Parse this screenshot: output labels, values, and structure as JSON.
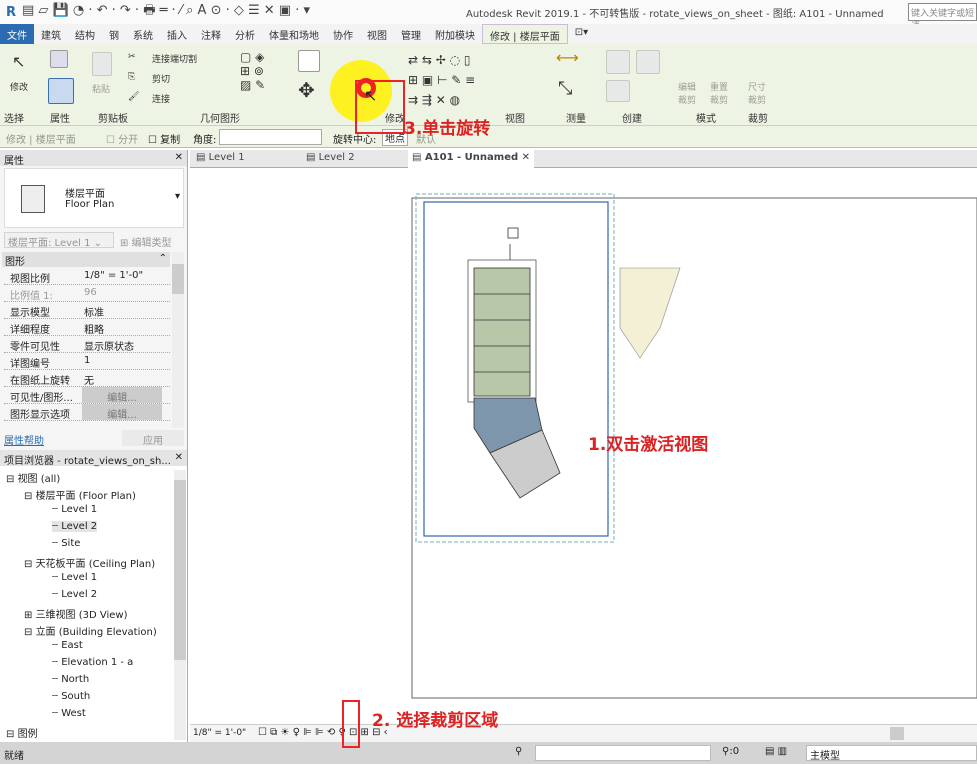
{
  "app": {
    "title": "Autodesk Revit 2019.1 - 不可转售版 - rotate_views_on_sheet - 图纸: A101 - Unnamed",
    "search_placeholder": "键入关键字或短语"
  },
  "menu_tabs": [
    "文件",
    "建筑",
    "结构",
    "钢",
    "系统",
    "插入",
    "注释",
    "分析",
    "体量和场地",
    "协作",
    "视图",
    "管理",
    "附加模块",
    "修改 | 楼层平面"
  ],
  "ribbon": {
    "buttons": [
      "修改",
      "粘贴",
      "连接端切割",
      "剪切",
      "连接"
    ],
    "groups": [
      "选择",
      "属性",
      "剪贴板",
      "几何图形",
      "修改",
      "视图",
      "测量",
      "创建",
      "模式",
      "裁剪"
    ],
    "crop_buttons": [
      "编辑裁剪",
      "重置裁剪",
      "尺寸裁剪"
    ]
  },
  "options_bar": {
    "context": "修改 | 楼层平面",
    "split": "分开",
    "copy": "复制",
    "angle_label": "角度:",
    "angle_value": "",
    "center_label": "旋转中心:",
    "place": "地点",
    "default": "默认"
  },
  "properties": {
    "title": "属性",
    "type_cn": "楼层平面",
    "type_en": "Floor Plan",
    "selector": "楼层平面: Level 1",
    "edit_type": "编辑类型",
    "section": "图形",
    "rows": [
      {
        "k": "视图比例",
        "v": "1/8\" = 1'-0\""
      },
      {
        "k": "比例值 1:",
        "v": "96"
      },
      {
        "k": "显示模型",
        "v": "标准"
      },
      {
        "k": "详细程度",
        "v": "粗略"
      },
      {
        "k": "零件可见性",
        "v": "显示原状态"
      },
      {
        "k": "详图编号",
        "v": "1"
      },
      {
        "k": "在图纸上旋转",
        "v": "无"
      },
      {
        "k": "可见性/图形...",
        "v": "编辑..."
      },
      {
        "k": "图形显示选项",
        "v": "编辑..."
      }
    ],
    "help": "属性帮助",
    "apply": "应用"
  },
  "browser": {
    "title": "项目浏览器 - rotate_views_on_sh...",
    "items": [
      {
        "label": "视图 (all)",
        "level": 0
      },
      {
        "label": "楼层平面 (Floor Plan)",
        "level": 1
      },
      {
        "label": "Level 1",
        "level": 2
      },
      {
        "label": "Level 2",
        "level": 2,
        "selected": true
      },
      {
        "label": "Site",
        "level": 2
      },
      {
        "label": "天花板平面 (Ceiling Plan)",
        "level": 1
      },
      {
        "label": "Level 1",
        "level": 2
      },
      {
        "label": "Level 2",
        "level": 2
      },
      {
        "label": "三维视图 (3D View)",
        "level": 1
      },
      {
        "label": "立面 (Building Elevation)",
        "level": 1
      },
      {
        "label": "East",
        "level": 2
      },
      {
        "label": "Elevation 1 - a",
        "level": 2
      },
      {
        "label": "North",
        "level": 2
      },
      {
        "label": "South",
        "level": 2
      },
      {
        "label": "West",
        "level": 2
      },
      {
        "label": "图例",
        "level": 0
      }
    ]
  },
  "view_tabs": [
    {
      "label": "Level 1"
    },
    {
      "label": "Level 2"
    },
    {
      "label": "A101 - Unnamed",
      "active": true
    }
  ],
  "view_control": {
    "scale": "1/8\" = 1'-0\""
  },
  "status": {
    "text": "就绪",
    "count": ":0",
    "model": "主模型"
  },
  "annotations": {
    "step1": "1.双击激活视图",
    "step2": "2. 选择裁剪区域",
    "step3": "3.单击旋转",
    "color": "#dd2222"
  }
}
